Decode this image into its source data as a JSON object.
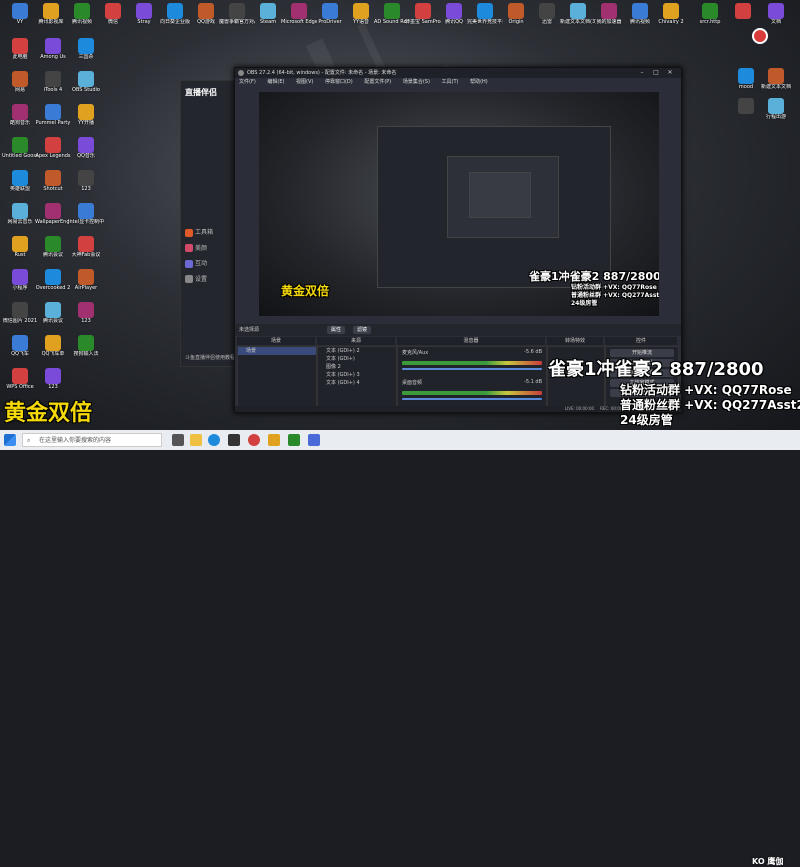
{
  "desktop_icons_top": [
    "VY",
    "腾讯影视库",
    "腾讯视频",
    "微信",
    "Stray",
    "向日葵企业版",
    "QQ游戏",
    "魔兽争霸官方对战平台",
    "Steam",
    "Microsoft Edge",
    "ProDriver",
    "YY语音",
    "AD Sound Recorder",
    "轩墨宝 SamPro机屏",
    "腾讯QQ",
    "完美世界竞技平台",
    "Origin",
    "迅雷",
    "新建文本文档(3)",
    "我的加速器",
    "腾讯视频",
    "Chivalry 2",
    "srcr.http",
    "",
    "文档"
  ],
  "desktop_icons_left": [
    "此电脑",
    "Among Us",
    "三国杀",
    "网易",
    "iTools 4",
    "OBS Studio",
    "酷狗音乐",
    "Pummel Party",
    "YY开播",
    "Untitled Goose Game",
    "Apex Legends",
    "QQ音乐",
    "英雄联盟",
    "Shotcut",
    "123",
    "网易云音乐",
    "WallpaperEngine",
    "Intel显卡控制中心",
    "Rust",
    "腾讯会议",
    "大神Fab会议",
    "小程序",
    "Overcooked 2",
    "AirPlayer",
    "微信图片 2021",
    "腾讯会议",
    "123",
    "QQ飞车",
    "QQ飞车单",
    "搜狗输入法",
    "WPS Office",
    "123"
  ],
  "desktop_icons_right": [
    "mood",
    "新建文本文档",
    "",
    "行程出游"
  ],
  "streamer_app": {
    "logo": "直播伴侣",
    "menu": [
      "工具箱",
      "美颜",
      "互动",
      "设置"
    ],
    "footer": "斗鱼直播伴侣使用教程"
  },
  "obs": {
    "title": "OBS 27.2.4 (64-bit, windows) - 配置文件: 未命名 - 场景: 未命名",
    "menu": [
      "文件(F)",
      "编辑(E)",
      "视图(V)",
      "停靠窗口(D)",
      "配置文件(P)",
      "场景集合(S)",
      "工具(T)",
      "帮助(H)"
    ],
    "status_left": "未选择源",
    "status_buttons": [
      "属性",
      "滤镜"
    ],
    "docks": {
      "scenes": "场景",
      "sources": "来源",
      "mixer": "混音器",
      "transitions": "转场特效",
      "controls": "控件"
    },
    "scene_item": "场景",
    "source_items": [
      "文本 (GDI+) 2",
      "文本 (GDI+)",
      "图像 2",
      "文本 (GDI+) 3",
      "文本 (GDI+) 4"
    ],
    "mixer_tracks": [
      {
        "name": "麦克风/Aux",
        "level": "-5.6 dB"
      },
      {
        "name": "桌面音频",
        "level": "-5.1 dB"
      }
    ],
    "controls": [
      "开始推流",
      "开始录制",
      "启动虚拟摄像机",
      "工作室模式",
      "设置",
      "退出"
    ],
    "statusbar": {
      "live": "LIVE: 00:00:00",
      "rec": "REC: 00:00:00",
      "cpu": "CPU: 1.3%, 30.00 fps"
    }
  },
  "overlay": {
    "gold_big": "黄金双倍",
    "gold_small": "黄金双倍",
    "rank_big": "雀豪1冲雀豪2 887/2800",
    "rank_small": "雀豪1冲雀豪2 887/2800",
    "promo_lines": [
      "钻粉活动群 +VX: QQ77Rose",
      "普通粉丝群 +VX: QQ277Asst2",
      "24级房管"
    ],
    "promo_lines_small": [
      "钻粉活动群 +VX: QQ77Rose",
      "普通粉丝群 +VX: QQ277Asst2",
      "24级房管"
    ]
  },
  "taskbar": {
    "search_placeholder": "在这里输入你要搜索的内容",
    "clock_time": "",
    "brand": "KO 鹰伽"
  },
  "colors": {
    "gold": "#f5d90a",
    "obs_bg": "#2b2e38",
    "taskbar": "#e9edf2"
  }
}
